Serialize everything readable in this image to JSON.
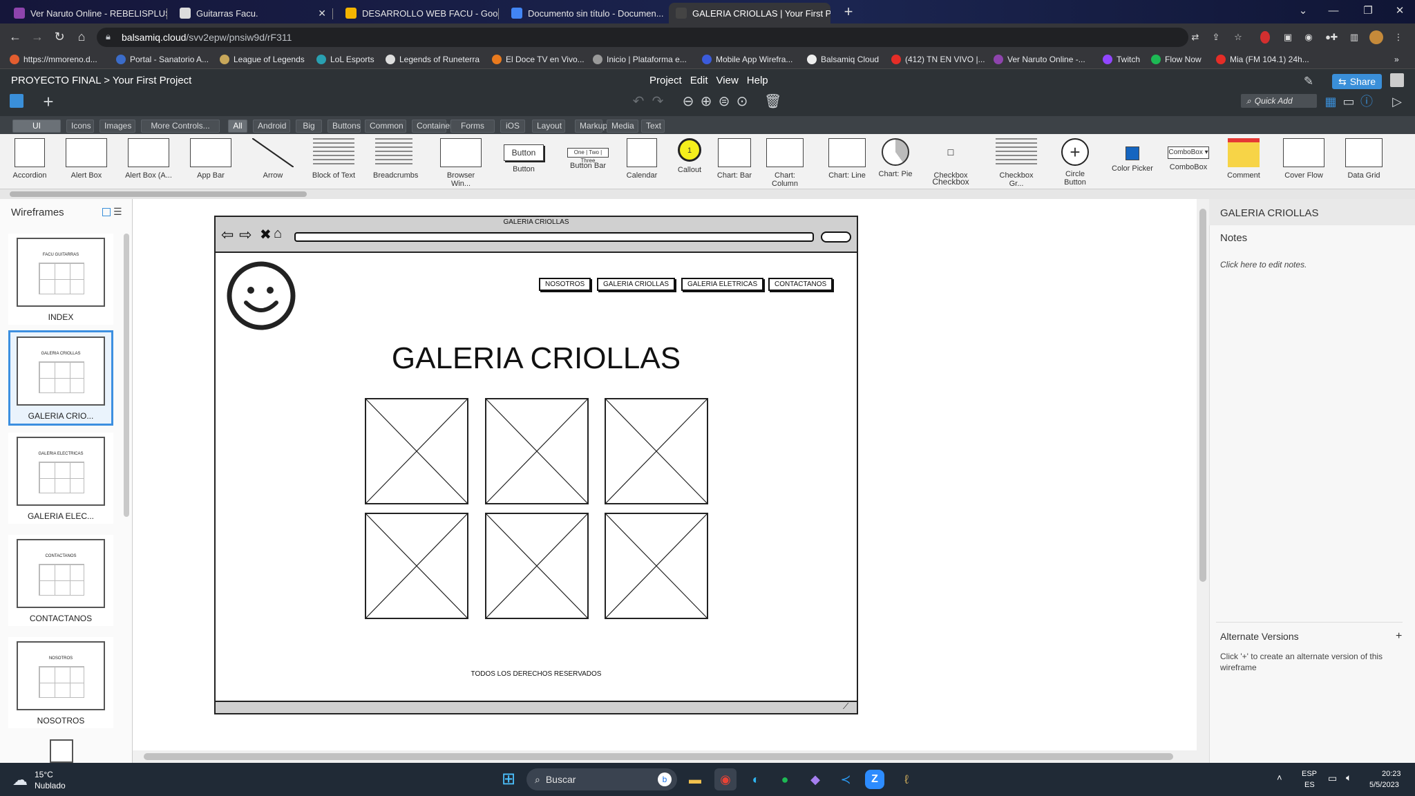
{
  "tabs": [
    {
      "label": "Ver Naruto Online - REBELISPLUS",
      "fav": "#8e44ad"
    },
    {
      "label": "Guitarras Facu.",
      "fav": "#dcdcdc"
    },
    {
      "label": "DESARROLLO WEB FACU - Goo...",
      "fav": "#f4b400"
    },
    {
      "label": "Documento sin título - Documen...",
      "fav": "#4285f4"
    },
    {
      "label": "GALERIA CRIOLLAS | Your First P...",
      "fav": "#444444"
    }
  ],
  "address": {
    "host": "balsamiq.cloud",
    "path": "/svv2epw/pnsiw9d/rF311"
  },
  "bookmarks": [
    {
      "label": "https://mmoreno.d...",
      "color": "#e35d2f"
    },
    {
      "label": "Portal - Sanatorio A...",
      "color": "#3b6cc9"
    },
    {
      "label": "League of Legends",
      "color": "#c8a75a"
    },
    {
      "label": "LoL Esports",
      "color": "#29a0b1"
    },
    {
      "label": "Legends of Runeterra",
      "color": "#ddd"
    },
    {
      "label": "El Doce TV en Vivo...",
      "color": "#e97a1e"
    },
    {
      "label": "Inicio | Plataforma e...",
      "color": "#999"
    },
    {
      "label": "Mobile App Wirefra...",
      "color": "#3b5bdb"
    },
    {
      "label": "Balsamiq Cloud",
      "color": "#eee"
    },
    {
      "label": "(412) TN EN VIVO |...",
      "color": "#e52d27"
    },
    {
      "label": "Ver Naruto Online -...",
      "color": "#8e44ad"
    },
    {
      "label": "Twitch",
      "color": "#9146ff"
    },
    {
      "label": "Flow Now",
      "color": "#1db954"
    },
    {
      "label": "Mia (FM 104.1) 24h...",
      "color": "#e52d27"
    }
  ],
  "app": {
    "breadcrumb": "PROYECTO FINAL > Your First Project",
    "menu": [
      "Project",
      "Edit",
      "View",
      "Help"
    ],
    "share": "Share",
    "quick_add": "Quick Add"
  },
  "libraries": [
    "UI Controls",
    "Icons",
    "Images",
    "More Controls...",
    "All",
    "Android",
    "Big",
    "Buttons",
    "Common",
    "Containers",
    "Forms",
    "iOS",
    "Layout",
    "Markup",
    "Media",
    "Text"
  ],
  "controls": [
    "Accordion",
    "Alert Box",
    "Alert Box (A...",
    "App Bar",
    "Arrow",
    "Block of Text",
    "Breadcrumbs",
    "Browser Win...",
    "Button",
    "Button Bar",
    "Calendar",
    "Callout",
    "Chart: Bar",
    "Chart: Column",
    "Chart: Line",
    "Chart: Pie",
    "Checkbox",
    "Checkbox Gr...",
    "Circle Button",
    "Color Picker",
    "ComboBox",
    "Comment",
    "Cover Flow",
    "Data Grid"
  ],
  "control_texts": {
    "button": "Button",
    "checkbox": "Checkbox",
    "combobox": "ComboBox",
    "callout": "1",
    "buttonbar": [
      "One",
      "Two",
      "Three"
    ]
  },
  "wireframes": {
    "title": "Wireframes",
    "items": [
      {
        "label": "INDEX",
        "sub": "FACU GUITARRAS"
      },
      {
        "label": "GALERIA CRIO...",
        "sub": "GALERIA CRIOLLAS"
      },
      {
        "label": "GALERIA ELEC...",
        "sub": "GALERIA ELECTRICAS"
      },
      {
        "label": "CONTACTANOS",
        "sub": "CONTACTANOS"
      },
      {
        "label": "NOSOTROS",
        "sub": "NOSOTROS"
      }
    ]
  },
  "mockup": {
    "window_title": "GALERIA CRIOLLAS",
    "nav": [
      "NOSOTROS",
      "GALERIA CRIOLLAS",
      "GALERIA ELETRICAS",
      "CONTACTANOS"
    ],
    "heading": "GALERIA CRIOLLAS",
    "footer": "TODOS LOS DERECHOS RESERVADOS"
  },
  "right": {
    "title": "GALERIA CRIOLLAS",
    "notes_label": "Notes",
    "notes_hint": "Click here to edit notes.",
    "alt_label": "Alternate Versions",
    "alt_hint": "Click '+' to create an alternate version of this wireframe"
  },
  "taskbar": {
    "weather_temp": "15°C",
    "weather_desc": "Nublado",
    "search": "Buscar",
    "lang": "ESP",
    "lang2": "ES",
    "time": "20:23",
    "date": "5/5/2023"
  }
}
